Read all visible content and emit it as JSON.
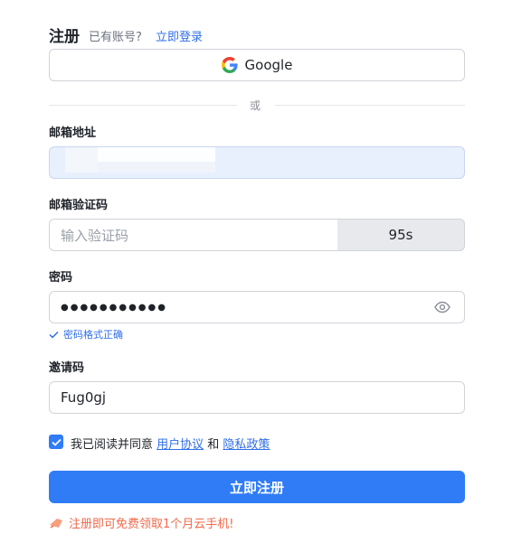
{
  "header": {
    "title": "注册",
    "have_account": "已有账号?",
    "login_link": "立即登录"
  },
  "google": {
    "label": "Google"
  },
  "divider": {
    "text": "或"
  },
  "email": {
    "label": "邮箱地址",
    "value": ""
  },
  "code": {
    "label": "邮箱验证码",
    "placeholder": "输入验证码",
    "countdown": "95s"
  },
  "password": {
    "label": "密码",
    "masked": "●●●●●●●●●●●",
    "hint": "密码格式正确"
  },
  "invite": {
    "label": "邀请码",
    "value": "Fug0gj"
  },
  "agreement": {
    "checked": true,
    "prefix": "我已阅读并同意 ",
    "terms": "用户协议",
    "and": " 和 ",
    "privacy": "隐私政策"
  },
  "submit": {
    "label": "立即注册"
  },
  "promo": {
    "text": "注册即可免费领取1个月云手机!"
  },
  "colors": {
    "accent": "#2f7cf6",
    "link": "#2f6ee8",
    "promo": "#f06a4b"
  }
}
